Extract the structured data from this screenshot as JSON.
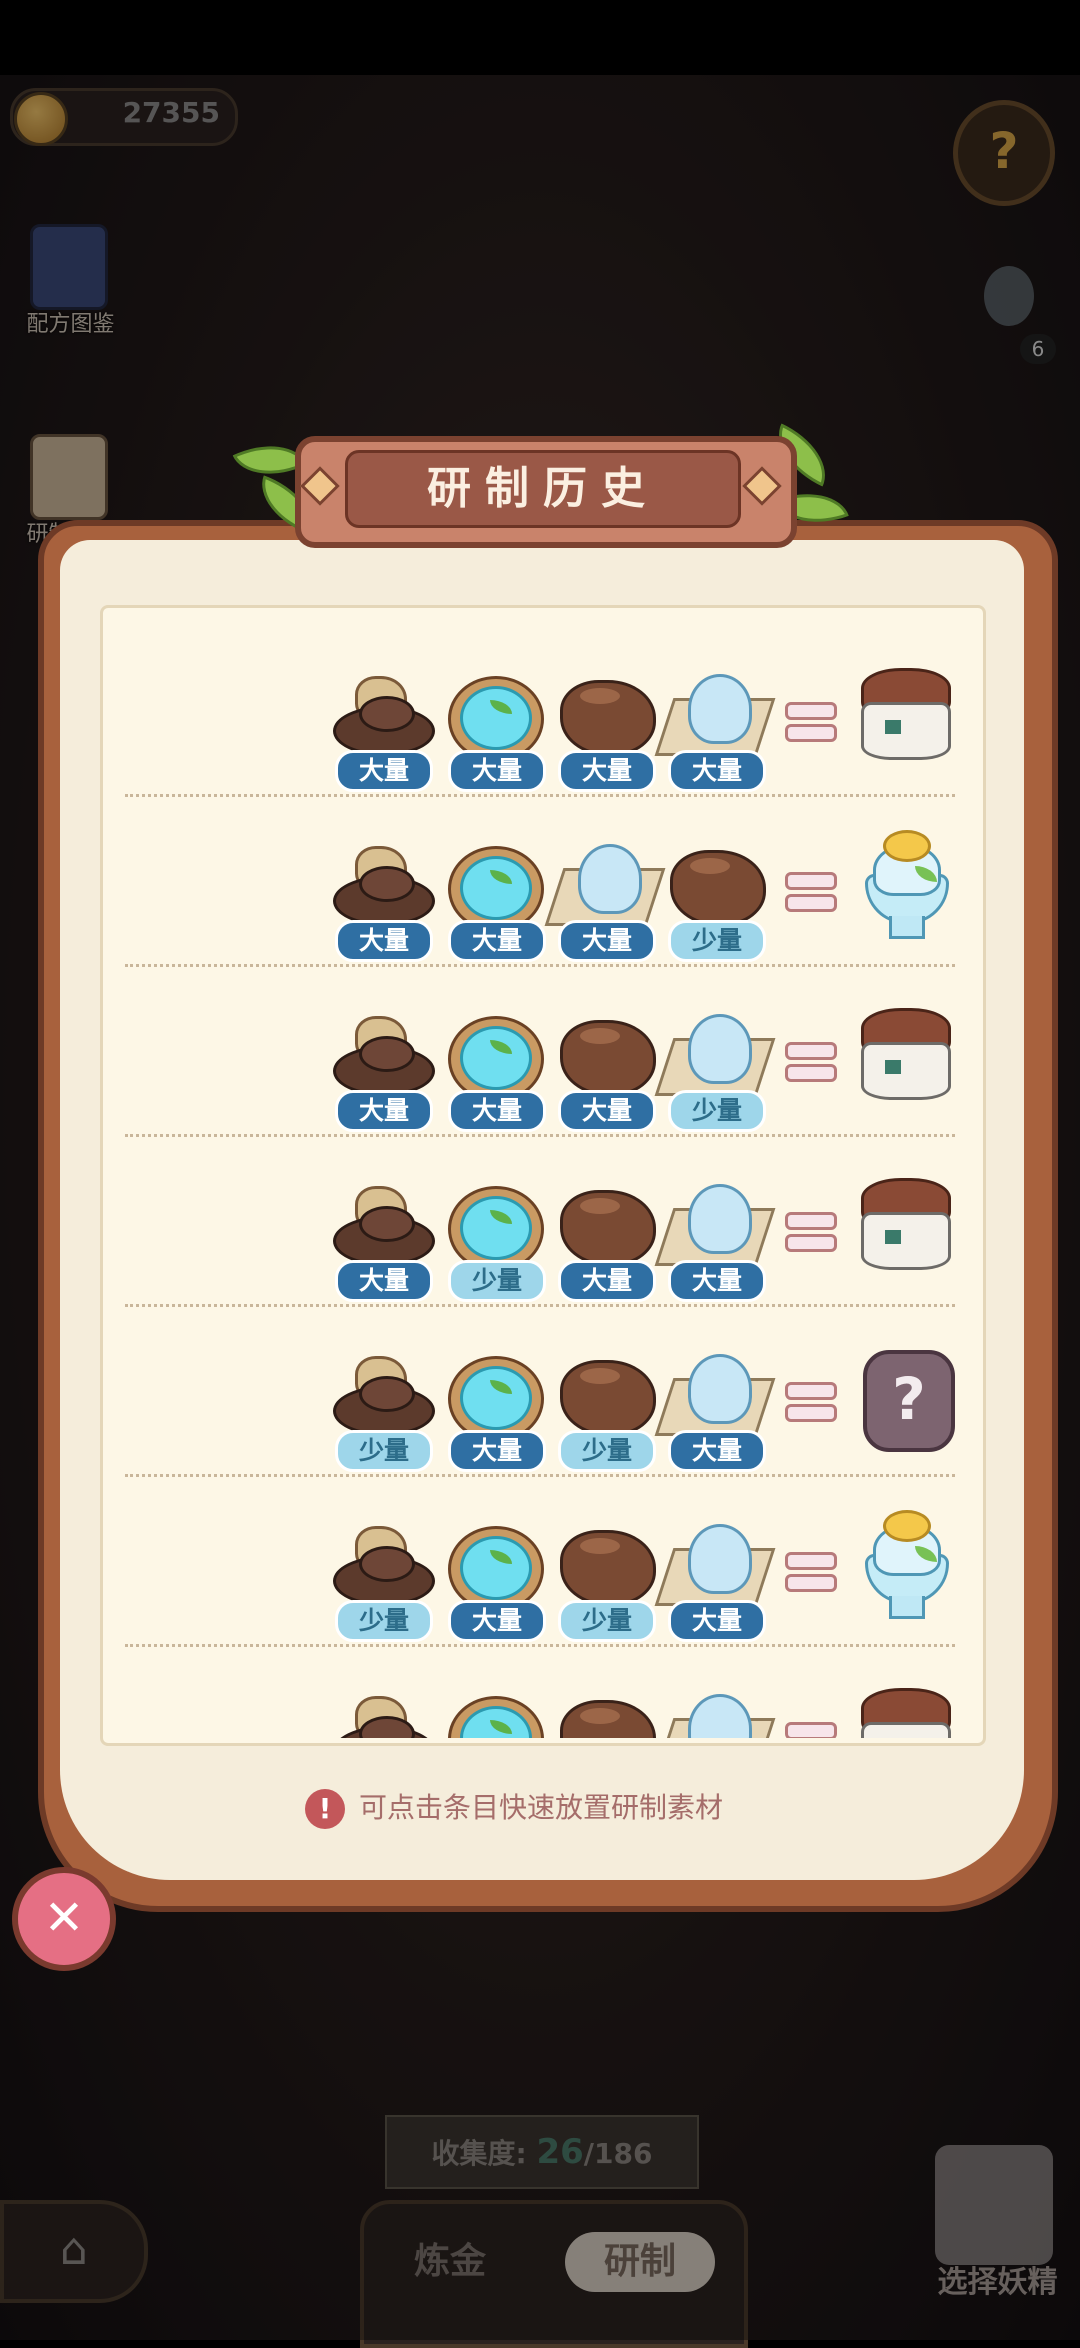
{
  "hud": {
    "coins": "27355",
    "help_icon": "question-mark-icon",
    "recipe_book_label": "配方图鉴",
    "history_side_label": "研制历史",
    "hint_count": "6"
  },
  "modal": {
    "title": "研制历史",
    "hint_text": "可点击条目快速放置研制素材",
    "equals_icon": "equals-icon",
    "rows": [
      {
        "ingredients": [
          {
            "item": "herb-pile",
            "qty": "大量",
            "level": "big"
          },
          {
            "item": "water-bowl",
            "qty": "大量",
            "level": "big"
          },
          {
            "item": "soil-lump",
            "qty": "大量",
            "level": "big"
          },
          {
            "item": "ice-paper",
            "qty": "大量",
            "level": "big"
          }
        ],
        "result": "jar"
      },
      {
        "ingredients": [
          {
            "item": "herb-pile",
            "qty": "大量",
            "level": "big"
          },
          {
            "item": "water-bowl",
            "qty": "大量",
            "level": "big"
          },
          {
            "item": "ice-paper",
            "qty": "大量",
            "level": "big"
          },
          {
            "item": "soil-lump",
            "qty": "少量",
            "level": "small"
          }
        ],
        "result": "shaved-ice"
      },
      {
        "ingredients": [
          {
            "item": "herb-pile",
            "qty": "大量",
            "level": "big"
          },
          {
            "item": "water-bowl",
            "qty": "大量",
            "level": "big"
          },
          {
            "item": "soil-lump",
            "qty": "大量",
            "level": "big"
          },
          {
            "item": "ice-paper",
            "qty": "少量",
            "level": "small"
          }
        ],
        "result": "jar"
      },
      {
        "ingredients": [
          {
            "item": "herb-pile",
            "qty": "大量",
            "level": "big"
          },
          {
            "item": "water-bowl",
            "qty": "少量",
            "level": "small"
          },
          {
            "item": "soil-lump",
            "qty": "大量",
            "level": "big"
          },
          {
            "item": "ice-paper",
            "qty": "大量",
            "level": "big"
          }
        ],
        "result": "jar"
      },
      {
        "ingredients": [
          {
            "item": "herb-pile",
            "qty": "少量",
            "level": "small"
          },
          {
            "item": "water-bowl",
            "qty": "大量",
            "level": "big"
          },
          {
            "item": "soil-lump",
            "qty": "少量",
            "level": "small"
          },
          {
            "item": "ice-paper",
            "qty": "大量",
            "level": "big"
          }
        ],
        "result": "unknown"
      },
      {
        "ingredients": [
          {
            "item": "herb-pile",
            "qty": "少量",
            "level": "small"
          },
          {
            "item": "water-bowl",
            "qty": "大量",
            "level": "big"
          },
          {
            "item": "soil-lump",
            "qty": "少量",
            "level": "small"
          },
          {
            "item": "ice-paper",
            "qty": "大量",
            "level": "big"
          }
        ],
        "result": "shaved-ice"
      },
      {
        "ingredients": [
          {
            "item": "herb-pile",
            "qty": "",
            "level": "big"
          },
          {
            "item": "water-bowl",
            "qty": "",
            "level": "big"
          },
          {
            "item": "soil-lump",
            "qty": "",
            "level": "big"
          },
          {
            "item": "ice-paper",
            "qty": "",
            "level": "big"
          }
        ],
        "result": "jar"
      }
    ],
    "colors": {
      "badge_big": "#2f6fa3",
      "badge_small": "#9ed6ea",
      "panel": "#a8613d",
      "paper": "#fdf7e6"
    }
  },
  "bottom": {
    "collection_label": "收集度:",
    "collection_current": "26",
    "collection_total": "/186",
    "tab_alchemy": "炼金",
    "tab_craft": "研制",
    "select_spirit": "选择妖精"
  }
}
